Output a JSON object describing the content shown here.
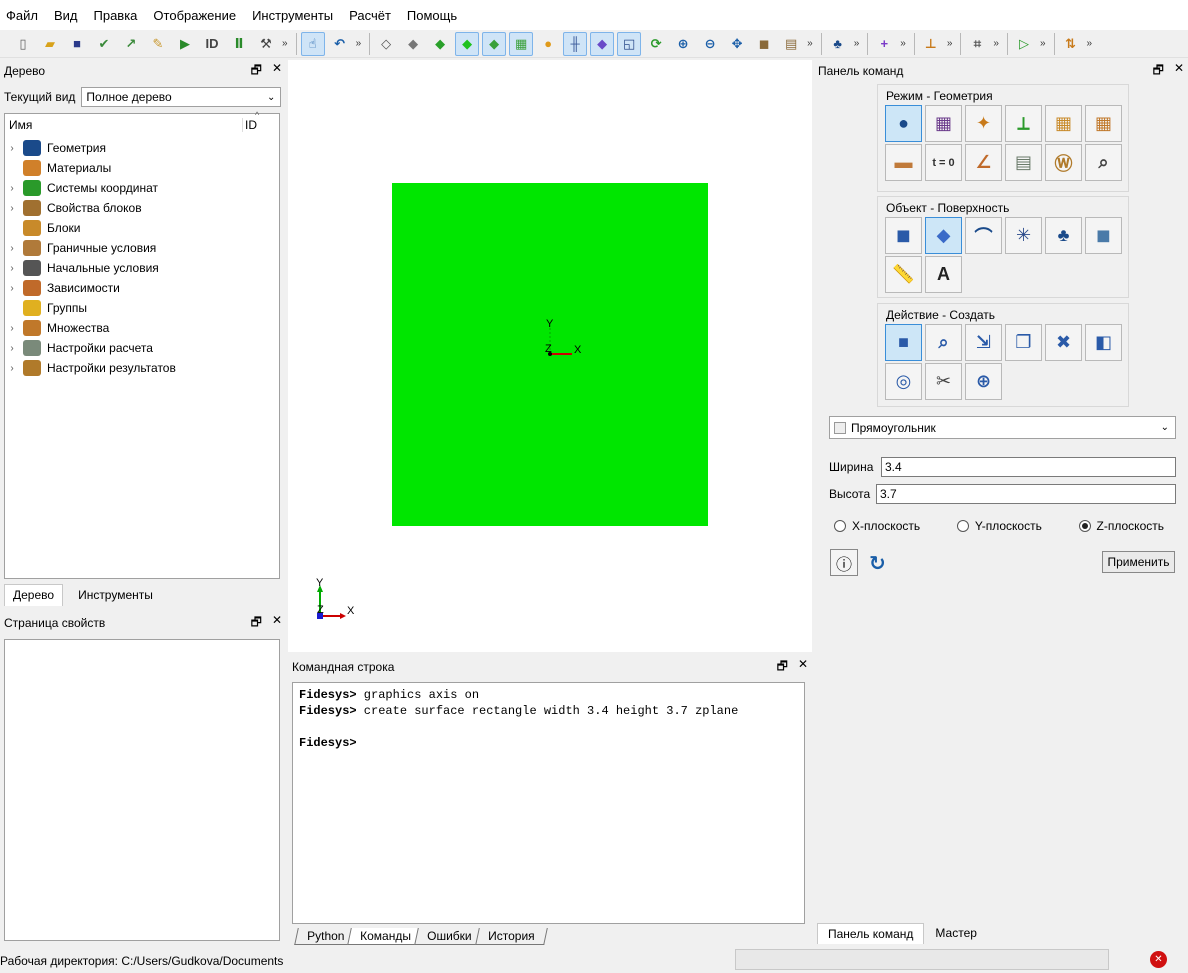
{
  "menu": [
    "Файл",
    "Вид",
    "Правка",
    "Отображение",
    "Инструменты",
    "Расчёт",
    "Помощь"
  ],
  "toolbar": {
    "groups": [
      [
        {
          "name": "new-file",
          "glyph": "▯",
          "color": "#666",
          "active": false
        },
        {
          "name": "open-folder",
          "glyph": "▰",
          "color": "#d8a21a",
          "active": false
        },
        {
          "name": "save",
          "glyph": "■",
          "color": "#2a3a8a",
          "active": false
        },
        {
          "name": "save-check",
          "glyph": "✔",
          "color": "#3a8a3a",
          "active": false
        },
        {
          "name": "save-export",
          "glyph": "↗",
          "color": "#3a8a3a",
          "active": false
        },
        {
          "name": "edit-script",
          "glyph": "✎",
          "color": "#c8962a",
          "active": false
        },
        {
          "name": "run-script",
          "glyph": "▶",
          "color": "#2a8a2a",
          "active": false
        },
        {
          "name": "id-file",
          "glyph": "ID",
          "color": "#444",
          "active": false
        },
        {
          "name": "pause",
          "glyph": "Ⅱ",
          "color": "#2a8a2a",
          "active": false
        },
        {
          "name": "hammer",
          "glyph": "⚒",
          "color": "#444",
          "active": false
        }
      ],
      [
        {
          "name": "select-mode",
          "glyph": "☝",
          "color": "#1a5ea8",
          "active": true
        },
        {
          "name": "undo",
          "glyph": "↶",
          "color": "#1a5ea8",
          "active": false
        }
      ],
      [
        {
          "name": "wireframe",
          "glyph": "◇",
          "color": "#555",
          "active": false
        },
        {
          "name": "hidden-line",
          "glyph": "◆",
          "color": "#777",
          "active": false
        },
        {
          "name": "shaded",
          "glyph": "◆",
          "color": "#2aa02a",
          "active": false
        },
        {
          "name": "smooth-shaded",
          "glyph": "◆",
          "color": "#1fc21f",
          "active": true
        },
        {
          "name": "multi-shaded",
          "glyph": "◆",
          "color": "#3aa03a",
          "active": true
        },
        {
          "name": "mesh-shaded",
          "glyph": "▦",
          "color": "#3aa03a",
          "active": true
        },
        {
          "name": "lights",
          "glyph": "●",
          "color": "#e09a1a",
          "active": false
        },
        {
          "name": "grid",
          "glyph": "╫",
          "color": "#3a5a9a",
          "active": true
        },
        {
          "name": "transparent-box",
          "glyph": "◆",
          "color": "#6a4ac8",
          "active": true
        },
        {
          "name": "windows",
          "glyph": "◱",
          "color": "#2a4a8a",
          "active": true
        },
        {
          "name": "refresh",
          "glyph": "⟳",
          "color": "#2a9a2a",
          "active": false
        },
        {
          "name": "zoom-in",
          "glyph": "⊕",
          "color": "#1a5ea8",
          "active": false
        },
        {
          "name": "zoom-out",
          "glyph": "⊖",
          "color": "#1a5ea8",
          "active": false
        },
        {
          "name": "zoom-fit",
          "glyph": "✥",
          "color": "#1a5ea8",
          "active": false
        },
        {
          "name": "box",
          "glyph": "◼",
          "color": "#8a6a3a",
          "active": false
        },
        {
          "name": "ruler",
          "glyph": "▤",
          "color": "#8a6a3a",
          "active": false
        }
      ],
      [
        {
          "name": "groups",
          "glyph": "♣",
          "color": "#1a4a8a",
          "active": false
        }
      ],
      [
        {
          "name": "crosshair",
          "glyph": "+",
          "color": "#7a3ac8",
          "active": false
        }
      ],
      [
        {
          "name": "plane-align",
          "glyph": "⊥",
          "color": "#c87a1a",
          "active": false
        }
      ],
      [
        {
          "name": "node-frame",
          "glyph": "⌗",
          "color": "#555",
          "active": false
        }
      ],
      [
        {
          "name": "play",
          "glyph": "▷",
          "color": "#2a9a2a",
          "active": false
        }
      ],
      [
        {
          "name": "axis-z",
          "glyph": "⇅",
          "color": "#c87a1a",
          "active": false
        }
      ]
    ]
  },
  "tree_panel": {
    "title": "Дерево",
    "view_label": "Текущий вид",
    "view_value": "Полное дерево",
    "col_name": "Имя",
    "col_id": "ID",
    "items": [
      {
        "label": "Геометрия",
        "expandable": true,
        "icon": "geometry",
        "color": "#1a4a8a"
      },
      {
        "label": "Материалы",
        "expandable": false,
        "icon": "materials",
        "color": "#d0802a"
      },
      {
        "label": "Системы координат",
        "expandable": true,
        "icon": "coord-systems",
        "color": "#2a9a2a"
      },
      {
        "label": "Свойства блоков",
        "expandable": true,
        "icon": "block-props",
        "color": "#a07030"
      },
      {
        "label": "Блоки",
        "expandable": false,
        "icon": "blocks",
        "color": "#c88a2a"
      },
      {
        "label": "Граничные условия",
        "expandable": true,
        "icon": "boundary",
        "color": "#b07a3a"
      },
      {
        "label": "Начальные условия",
        "expandable": true,
        "icon": "initial",
        "color": "#555"
      },
      {
        "label": "Зависимости",
        "expandable": true,
        "icon": "dependencies",
        "color": "#c06a2a"
      },
      {
        "label": "Группы",
        "expandable": false,
        "icon": "groups",
        "color": "#e0b020"
      },
      {
        "label": "Множества",
        "expandable": true,
        "icon": "sets",
        "color": "#c0782a"
      },
      {
        "label": "Настройки расчета",
        "expandable": true,
        "icon": "calc-settings",
        "color": "#7a8a7a"
      },
      {
        "label": "Настройки результатов",
        "expandable": true,
        "icon": "results",
        "color": "#b07a2a"
      }
    ],
    "tabs": [
      "Дерево",
      "Инструменты"
    ]
  },
  "props_panel": {
    "title": "Страница свойств"
  },
  "viewport": {
    "surface_color": "#00e600",
    "axis_x": "X",
    "axis_y": "Y",
    "axis_z": "Z"
  },
  "console": {
    "title": "Командная строка",
    "lines": [
      {
        "prompt": "Fidesys>",
        "text": " graphics axis on"
      },
      {
        "prompt": "Fidesys>",
        "text": " create surface rectangle width 3.4 height 3.7 zplane"
      },
      {
        "prompt": "",
        "text": ""
      },
      {
        "prompt": "Fidesys>",
        "text": ""
      }
    ],
    "tabs": [
      "Python",
      "Команды",
      "Ошибки",
      "История"
    ]
  },
  "command_panel": {
    "title": "Панель команд",
    "group1_title": "Режим - Геометрия",
    "group1": [
      {
        "name": "geometry-mode",
        "glyph": "●",
        "color": "#1a4a8a",
        "sel": true
      },
      {
        "name": "mesh-mode",
        "glyph": "▦",
        "color": "#6a3a8a",
        "sel": false
      },
      {
        "name": "material-mode",
        "glyph": "✦",
        "color": "#c87a1a",
        "sel": false
      },
      {
        "name": "coord-mode",
        "glyph": "⟂",
        "color": "#2a9a2a",
        "sel": false
      },
      {
        "name": "block-mode",
        "glyph": "▦",
        "color": "#c88a2a",
        "sel": false
      },
      {
        "name": "sets-mode",
        "glyph": "▦",
        "color": "#c0782a",
        "sel": false
      },
      {
        "name": "bc-mode",
        "glyph": "▬",
        "color": "#c07a3a",
        "sel": false
      },
      {
        "name": "initial-mode",
        "glyph": "t = 0",
        "color": "#333",
        "sel": false
      },
      {
        "name": "dependency-mode",
        "glyph": "∠",
        "color": "#c06a2a",
        "sel": false
      },
      {
        "name": "calc-mode",
        "glyph": "▤",
        "color": "#6a7a6a",
        "sel": false
      },
      {
        "name": "results-mode",
        "glyph": "Ⓦ",
        "color": "#b07a2a",
        "sel": false
      },
      {
        "name": "inspect-mode",
        "glyph": "⌕",
        "color": "#444",
        "sel": false
      }
    ],
    "group2_title": "Объект - Поверхность",
    "group2": [
      {
        "name": "volume-object",
        "glyph": "◼",
        "color": "#2a5aa8",
        "sel": false
      },
      {
        "name": "surface-object",
        "glyph": "◆",
        "color": "#3a6ac8",
        "sel": true
      },
      {
        "name": "curve-object",
        "glyph": "⌒",
        "color": "#1a4a8a",
        "sel": false
      },
      {
        "name": "vertex-object",
        "glyph": "✳",
        "color": "#2a4a8a",
        "sel": false
      },
      {
        "name": "group-object",
        "glyph": "♣",
        "color": "#1a4a8a",
        "sel": false
      },
      {
        "name": "body-object",
        "glyph": "◼",
        "color": "#4a7aa8",
        "sel": false
      },
      {
        "name": "measure-object",
        "glyph": "📏",
        "color": "#5a6a9a",
        "sel": false
      },
      {
        "name": "text-object",
        "glyph": "A",
        "color": "#222",
        "sel": false
      }
    ],
    "group3_title": "Действие - Создать",
    "group3": [
      {
        "name": "create-action",
        "glyph": "■",
        "color": "#2a5aa8",
        "sel": true
      },
      {
        "name": "modify-action",
        "glyph": "⌕",
        "color": "#2a5aa8",
        "sel": false
      },
      {
        "name": "transform-action",
        "glyph": "⇲",
        "color": "#2a5aa8",
        "sel": false
      },
      {
        "name": "copy-action",
        "glyph": "❐",
        "color": "#2a5aa8",
        "sel": false
      },
      {
        "name": "delete-action",
        "glyph": "✖",
        "color": "#2a5aa8",
        "sel": false
      },
      {
        "name": "boolean-action",
        "glyph": "◧",
        "color": "#2a5aa8",
        "sel": false
      },
      {
        "name": "imprint-action",
        "glyph": "◎",
        "color": "#2a5aa8",
        "sel": false
      },
      {
        "name": "tools-action",
        "glyph": "✂",
        "color": "#444",
        "sel": false
      },
      {
        "name": "normal-action",
        "glyph": "⊕",
        "color": "#2a5aa8",
        "sel": false
      }
    ],
    "shape_value": "Прямоугольник",
    "width_label": "Ширина",
    "width_value": "3.4",
    "height_label": "Высота",
    "height_value": "3.7",
    "radio": [
      {
        "label": "X-плоскость",
        "checked": false
      },
      {
        "label": "Y-плоскость",
        "checked": false
      },
      {
        "label": "Z-плоскость",
        "checked": true
      }
    ],
    "apply_label": "Применить",
    "tabs": [
      "Панель команд",
      "Мастер"
    ]
  },
  "status": {
    "workdir": "Рабочая директория: C:/Users/Gudkova/Documents"
  }
}
